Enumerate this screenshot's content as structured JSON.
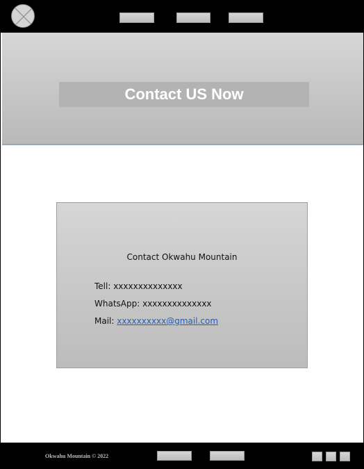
{
  "header": {
    "logo_icon": "placeholder-image-icon",
    "nav_items": [
      "",
      "",
      ""
    ]
  },
  "hero": {
    "title": "Contact US Now"
  },
  "contact": {
    "heading": "Contact Okwahu Mountain",
    "tell_label": "Tell: ",
    "tell_value": "xxxxxxxxxxxxxx",
    "whatsapp_label": "WhatsApp: ",
    "whatsapp_value": "xxxxxxxxxxxxxx",
    "mail_label": "Mail: ",
    "mail_value": "xxxxxxxxxx@gmail.com"
  },
  "footer": {
    "copyright": "Okwahu Mountain © 2022",
    "links": [
      "",
      ""
    ],
    "social_icons": [
      "social-icon-1",
      "social-icon-2",
      "social-icon-3"
    ]
  },
  "colors": {
    "bars": "#000000",
    "link": "#1f5fbf",
    "hero_title": "#ffffff"
  }
}
